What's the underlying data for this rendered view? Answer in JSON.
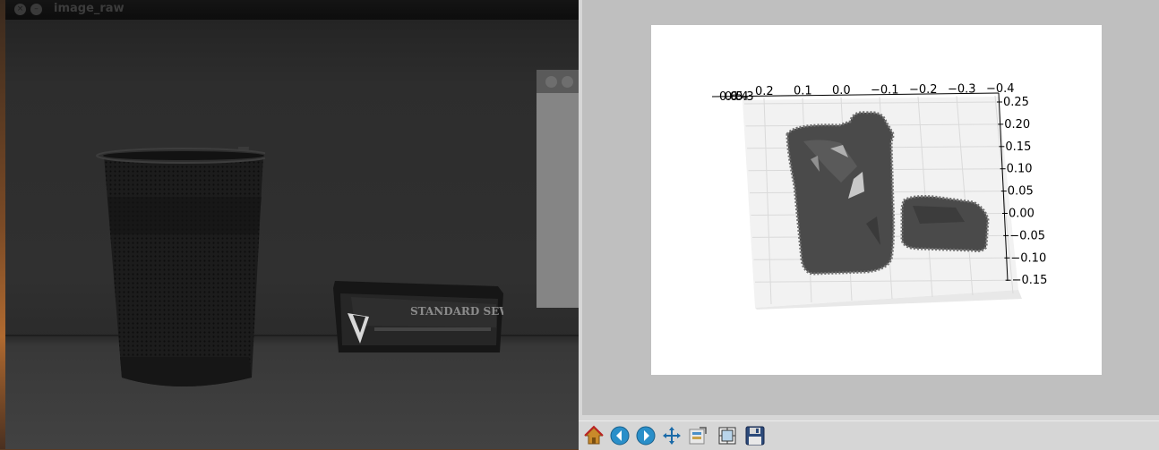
{
  "image_window": {
    "title": "image_raw",
    "product_label": "STANDARD SEWED"
  },
  "figure_window": {
    "toolbar": [
      {
        "name": "home",
        "icon": "home-icon",
        "interactable": true
      },
      {
        "name": "back",
        "icon": "back-arrow-icon",
        "interactable": true
      },
      {
        "name": "forward",
        "icon": "forward-arrow-icon",
        "interactable": true
      },
      {
        "name": "pan",
        "icon": "pan-icon",
        "interactable": true
      },
      {
        "name": "configure",
        "icon": "configure-subplots-icon",
        "interactable": true
      },
      {
        "name": "edit",
        "icon": "edit-axes-icon",
        "interactable": true
      },
      {
        "name": "save",
        "icon": "save-icon",
        "interactable": true
      }
    ]
  },
  "chart_data": {
    "type": "scatter",
    "projection": "3d",
    "x_tick_labels": [
      "0.2",
      "0.1",
      "0.0",
      "−0.1",
      "−0.2",
      "−0.3",
      "−0.4"
    ],
    "x_extra_ticks_overlapped": [
      "0.6",
      "0.5",
      "0.4",
      "0.3"
    ],
    "z_tick_labels": [
      "0.25",
      "0.20",
      "0.15",
      "0.10",
      "0.05",
      "0.00",
      "−0.05",
      "−0.10",
      "−0.15"
    ],
    "zlim": [
      -0.15,
      0.25
    ],
    "xlim": [
      0.6,
      -0.4
    ],
    "grid": true,
    "series": [
      {
        "name": "",
        "color": "#4a4a4a"
      }
    ],
    "clusters": [
      {
        "object": "pencil cup",
        "x_range": [
          0.12,
          -0.08
        ],
        "z_range": [
          -0.13,
          0.22
        ]
      },
      {
        "object": "eraser box",
        "x_range": [
          -0.09,
          -0.25
        ],
        "z_range": [
          -0.03,
          0.03
        ]
      }
    ]
  }
}
